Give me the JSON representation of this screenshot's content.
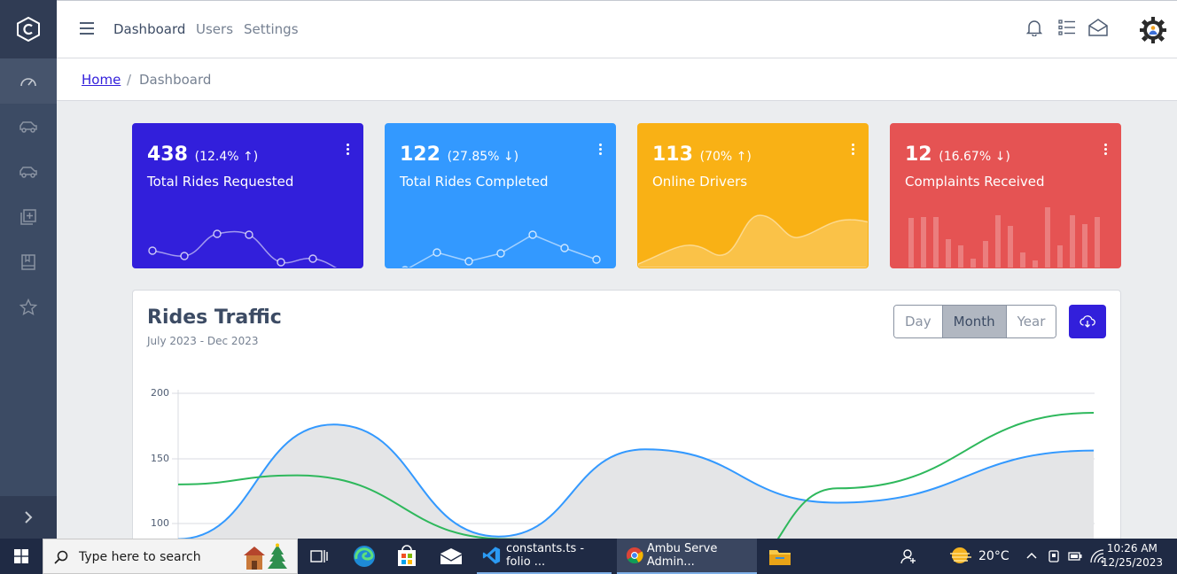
{
  "header": {
    "nav": [
      "Dashboard",
      "Users",
      "Settings"
    ]
  },
  "breadcrumb": {
    "home": "Home",
    "separator": "/",
    "current": "Dashboard"
  },
  "widgets": [
    {
      "value": "438",
      "pct": "(12.4% ↑)",
      "title": "Total Rides Requested",
      "color": "#321fdb"
    },
    {
      "value": "122",
      "pct": "(27.85% ↓)",
      "title": "Total Rides Completed",
      "color": "#3399ff"
    },
    {
      "value": "113",
      "pct": "(70% ↑)",
      "title": "Online Drivers",
      "color": "#f9b115"
    },
    {
      "value": "12",
      "pct": "(16.67% ↓)",
      "title": "Complaints Received",
      "color": "#e55353"
    }
  ],
  "traffic": {
    "title": "Rides Traffic",
    "subtitle": "July 2023 - Dec 2023",
    "buttons": [
      "Day",
      "Month",
      "Year"
    ],
    "selected": "Month"
  },
  "chart_data": {
    "type": "line",
    "title": "Rides Traffic",
    "ylim": [
      80,
      200
    ],
    "y_ticks": [
      200,
      150,
      100
    ],
    "grid": true,
    "series": [
      {
        "color": "#3399ff",
        "fill": "#e4e5e7",
        "points": [
          [
            0,
            88
          ],
          [
            0.17,
            176
          ],
          [
            0.35,
            90
          ],
          [
            0.51,
            157
          ],
          [
            0.72,
            116
          ],
          [
            1,
            156
          ]
        ]
      },
      {
        "color": "#2eb85c",
        "points": [
          [
            0,
            130
          ],
          [
            0.13,
            137
          ],
          [
            0.36,
            88
          ],
          [
            0.6,
            60
          ],
          [
            0.72,
            127
          ],
          [
            1,
            185
          ]
        ]
      }
    ]
  },
  "taskbar": {
    "search_placeholder": "Type here to search",
    "apps": [
      "constants.ts - folio ...",
      "Ambu Serve Admin..."
    ],
    "weather": "20°C",
    "time": "10:26 AM",
    "date": "12/25/2023"
  }
}
